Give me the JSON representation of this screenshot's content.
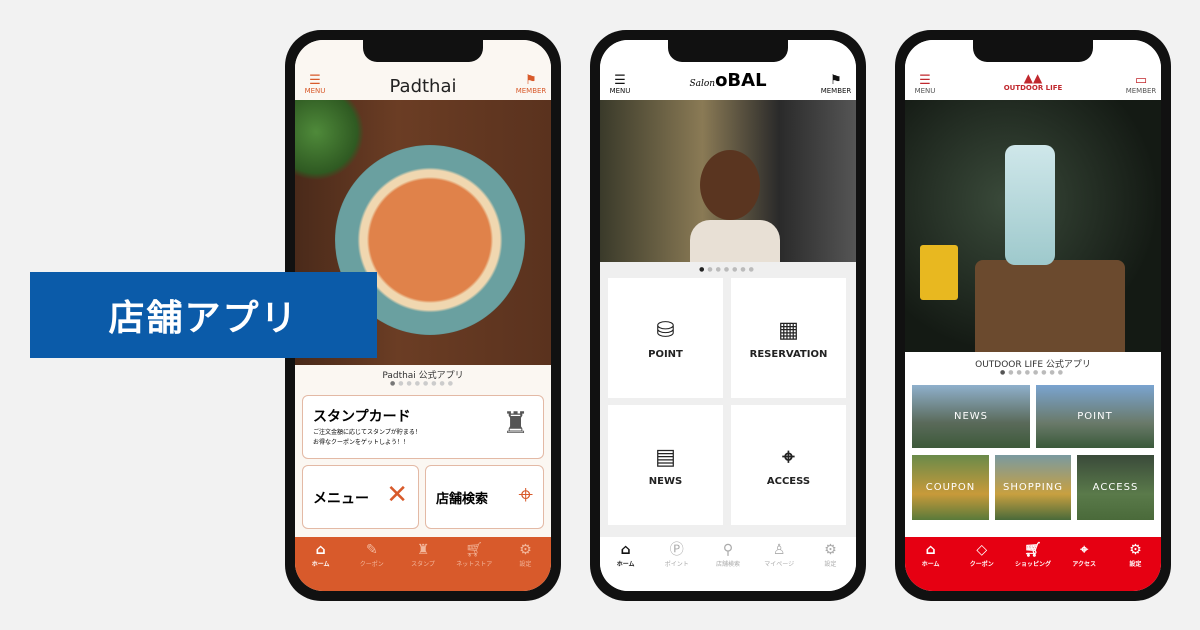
{
  "label": "店舗アプリ",
  "phone1": {
    "title": "Padthai",
    "menu": "MENU",
    "member": "MEMBER",
    "caption": "Padthai 公式アプリ",
    "stamp": {
      "title": "スタンプカード",
      "desc1": "ご注文金額に応じてスタンプが貯まる！",
      "desc2": "お得なクーポンをゲットしよう！！"
    },
    "menu_card": "メニュー",
    "store_card": "店舗検索",
    "tabs": [
      {
        "label": "ホーム",
        "icon": "home-icon"
      },
      {
        "label": "クーポン",
        "icon": "coupon-icon"
      },
      {
        "label": "スタンプ",
        "icon": "stamp-icon"
      },
      {
        "label": "ネットストア",
        "icon": "cart-icon"
      },
      {
        "label": "設定",
        "icon": "gear-icon"
      }
    ],
    "accent": "#d85a2b"
  },
  "phone2": {
    "logo_script": "Salon",
    "logo": "oBAL",
    "menu": "MENU",
    "member": "MEMBER",
    "grid": [
      {
        "label": "POINT",
        "icon": "coins-icon"
      },
      {
        "label": "RESERVATION",
        "icon": "calendar-icon"
      },
      {
        "label": "NEWS",
        "icon": "newspaper-icon"
      },
      {
        "label": "ACCESS",
        "icon": "map-pin-icon"
      }
    ],
    "tabs": [
      {
        "label": "ホーム",
        "icon": "home-icon"
      },
      {
        "label": "ポイント",
        "icon": "point-icon"
      },
      {
        "label": "店舗検索",
        "icon": "search-icon"
      },
      {
        "label": "マイページ",
        "icon": "user-icon"
      },
      {
        "label": "設定",
        "icon": "gear-icon"
      }
    ]
  },
  "phone3": {
    "logo": "OUTDOOR LIFE",
    "menu": "MENU",
    "member": "MEMBER",
    "caption": "OUTDOOR LIFE 公式アプリ",
    "grid": [
      "NEWS",
      "POINT",
      "COUPON",
      "SHOPPING",
      "ACCESS"
    ],
    "tabs": [
      {
        "label": "ホーム",
        "icon": "home-icon"
      },
      {
        "label": "クーポン",
        "icon": "tag-icon"
      },
      {
        "label": "ショッピング",
        "icon": "cart-icon"
      },
      {
        "label": "アクセス",
        "icon": "map-pin-icon"
      },
      {
        "label": "設定",
        "icon": "gear-icon"
      }
    ],
    "accent": "#e60012"
  }
}
